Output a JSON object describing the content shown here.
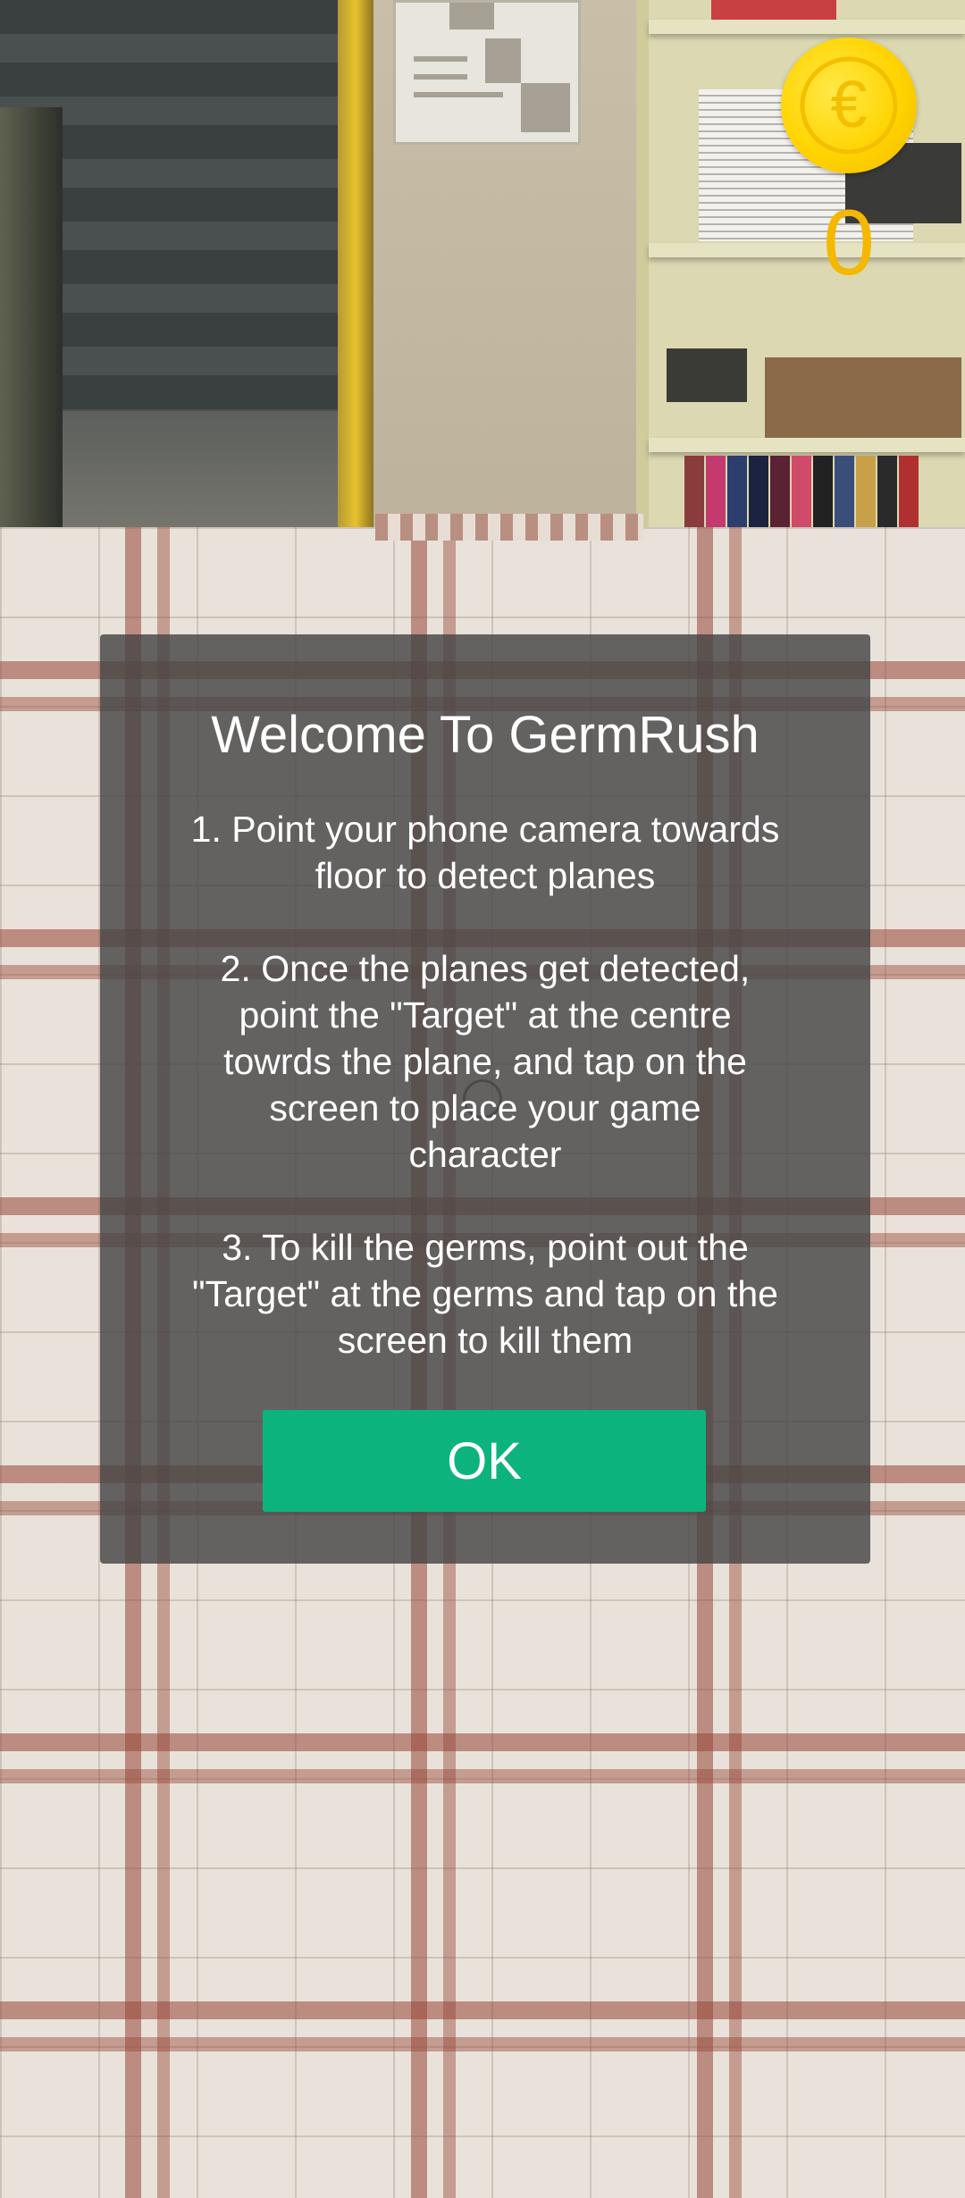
{
  "hud": {
    "coin_icon": "euro-coin-icon",
    "coin_count": "0",
    "coin_color": "#ffd400",
    "count_color": "#f4b800"
  },
  "dialog": {
    "title": "Welcome To GermRush",
    "instructions": [
      "1. Point your phone camera towards\nfloor to detect planes",
      "2. Once the planes get detected,\npoint the \"Target\" at the centre\ntowrds the plane, and tap on the\nscreen  to place your game\ncharacter",
      "3. To kill the germs, point out the\n\"Target\" at the germs and tap on the\nscreen to kill them"
    ],
    "ok_label": "OK",
    "ok_color": "#0db37d"
  },
  "ar_view": {
    "target_icon": "target-reticle-icon"
  }
}
